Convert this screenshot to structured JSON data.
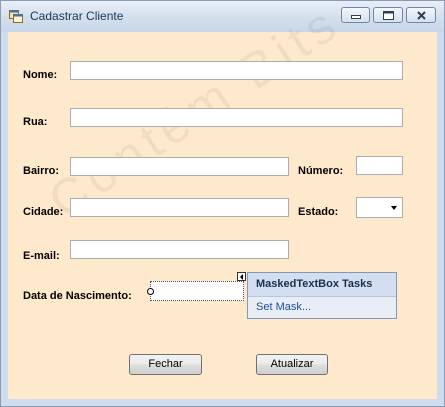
{
  "window": {
    "title": "Cadastrar Cliente",
    "icon": "form-app-icon",
    "controls": [
      "minimize-icon",
      "maximize-icon",
      "close-icon"
    ]
  },
  "watermark": "Contém Bits",
  "form": {
    "nome": {
      "label": "Nome:",
      "value": ""
    },
    "rua": {
      "label": "Rua:",
      "value": ""
    },
    "bairro": {
      "label": "Bairro:",
      "value": ""
    },
    "numero": {
      "label": "Número:",
      "value": ""
    },
    "cidade": {
      "label": "Cidade:",
      "value": ""
    },
    "estado": {
      "label": "Estado:",
      "selected": ""
    },
    "email": {
      "label": "E-mail:",
      "value": ""
    },
    "nascimento": {
      "label": "Data de Nascimento:",
      "value": ""
    }
  },
  "smart_tag": {
    "header": "MaskedTextBox Tasks",
    "action": "Set Mask..."
  },
  "buttons": {
    "fechar": "Fechar",
    "atualizar": "Atualizar"
  },
  "colors": {
    "form_background": "#ffe9cc",
    "title_bar": "#d5e0ee",
    "tasks_header": "#d3def0",
    "link": "#1d4fa0"
  }
}
